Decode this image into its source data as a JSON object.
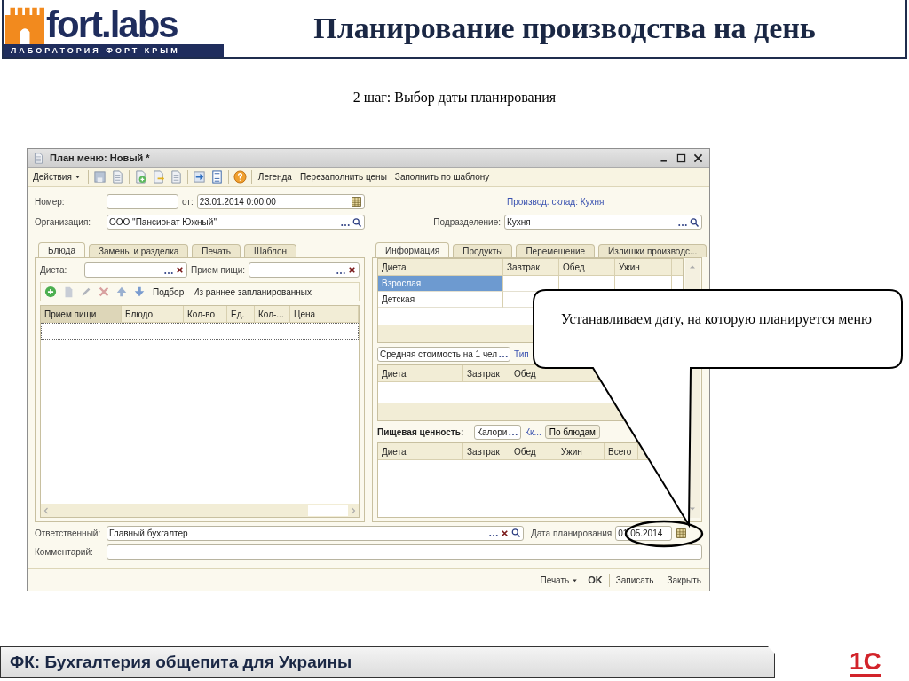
{
  "header": {
    "logo": {
      "name": "fort.labs",
      "tagline": "ЛАБОРАТОРИЯ ФОРТ КРЫМ"
    },
    "title": "Планирование производства на день"
  },
  "subtitle": "2 шаг: Выбор даты планирования",
  "window": {
    "title": "План меню: Новый *",
    "toolbar": {
      "menu": "Действия",
      "buttons": [
        "Легенда",
        "Перезаполнить цены",
        "Заполнить по шаблону"
      ]
    },
    "number": {
      "label": "Номер:"
    },
    "date": {
      "label": "от:",
      "value": "23.01.2014  0:00:00"
    },
    "organization": {
      "label": "Организация:",
      "value": "ООО \"Пансионат Южный\""
    },
    "warehouse_link": "Производ. склад: Кухня",
    "department": {
      "label": "Подразделение:",
      "value": "Кухня"
    },
    "left_tabs": [
      {
        "label": "Блюда",
        "selected": true
      },
      {
        "label": "Замены и разделка",
        "selected": false
      },
      {
        "label": "Печать",
        "selected": false
      },
      {
        "label": "Шаблон",
        "selected": false
      }
    ],
    "diet_filter": {
      "label": "Диета:"
    },
    "meal_filter": {
      "label": "Прием пищи:"
    },
    "dishes_toolbar": [
      "Подбор",
      "Из раннее запланированных"
    ],
    "dishes_columns": [
      {
        "label": "Прием пищи",
        "sorted": true
      },
      {
        "label": "Блюдо",
        "sorted": false
      },
      {
        "label": "Кол-во",
        "sorted": false
      },
      {
        "label": "Ед.",
        "sorted": false
      },
      {
        "label": "Кол-...",
        "sorted": false
      },
      {
        "label": "Цена",
        "sorted": false
      }
    ],
    "right_tabs": [
      {
        "label": "Информация",
        "selected": true
      },
      {
        "label": "Продукты",
        "selected": false
      },
      {
        "label": "Перемещение",
        "selected": false
      },
      {
        "label": "Излишки производс...",
        "selected": false
      }
    ],
    "diet_columns": [
      "Диета",
      "Завтрак",
      "Обед",
      "Ужин"
    ],
    "diet_rows": [
      {
        "diet": "Взрослая",
        "selected": true
      },
      {
        "diet": "Детская",
        "selected": false
      }
    ],
    "cost_select": "Средняя стоимость на 1 чел",
    "cost_link": "Тип",
    "cost_columns": [
      "Диета",
      "Завтрак",
      "Обед"
    ],
    "nutrition": {
      "label": "Пищевая ценность:",
      "select": "Калори",
      "link": "Кк...",
      "button": "По блюдам"
    },
    "nutrition_columns": [
      "Диета",
      "Завтрак",
      "Обед",
      "Ужин",
      "Всего"
    ],
    "responsible": {
      "label": "Ответственный:",
      "value": "Главный бухгалтер"
    },
    "planning_date": {
      "label": "Дата планирования",
      "value": "01.05.2014"
    },
    "comment": {
      "label": "Комментарий:"
    },
    "footer_buttons": [
      {
        "label": "Печать",
        "kind": "menu"
      },
      {
        "label": "OK",
        "kind": "default"
      },
      {
        "label": "Записать",
        "kind": "plain"
      },
      {
        "label": "Закрыть",
        "kind": "plain"
      }
    ]
  },
  "callout": "Устанавливаем дату, на которую планируется меню",
  "footer": {
    "title": "ФК: Бухгалтерия общепита для Украины",
    "logo": "1С"
  }
}
